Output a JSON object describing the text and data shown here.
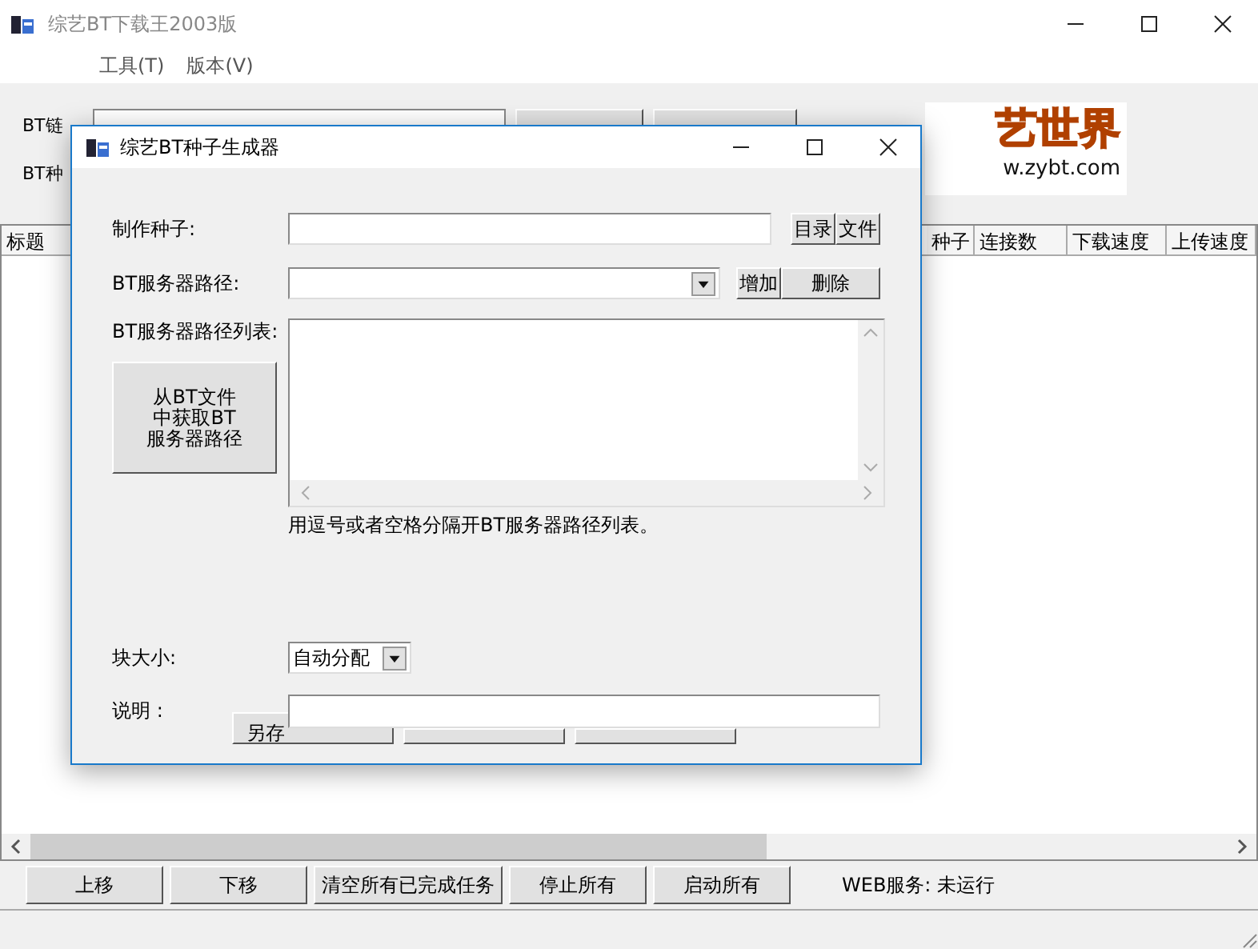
{
  "main_window": {
    "title": "综艺BT下载王2003版",
    "menu": [
      "工具(T)",
      "版本(V)"
    ],
    "link_label": "BT链",
    "seed_label": "BT种",
    "logo": {
      "text": "艺世界",
      "url": "w.zybt.com"
    },
    "table": {
      "first_column": "标题",
      "columns": [
        "种子",
        "连接数",
        "下载速度",
        "上传速度"
      ]
    },
    "buttons": [
      "上移",
      "下移",
      "清空所有已完成任务",
      "停止所有",
      "启动所有"
    ],
    "web_status": "WEB服务: 未运行"
  },
  "dialog": {
    "title": "综艺BT种子生成器",
    "seed_label": "制作种子:",
    "seed_buttons": [
      "目录",
      "文件"
    ],
    "server_label": "BT服务器路径:",
    "server_buttons": [
      "增加",
      "删除"
    ],
    "list_label": "BT服务器路径列表:",
    "fetch_button_lines": [
      "从BT文件",
      "中获取BT",
      "服务器路径"
    ],
    "hint": "用逗号或者空格分隔开BT服务器路径列表。",
    "block_label": "块大小:",
    "block_value": "自动分配",
    "desc_label": "说明 :",
    "save_button": "另存"
  }
}
